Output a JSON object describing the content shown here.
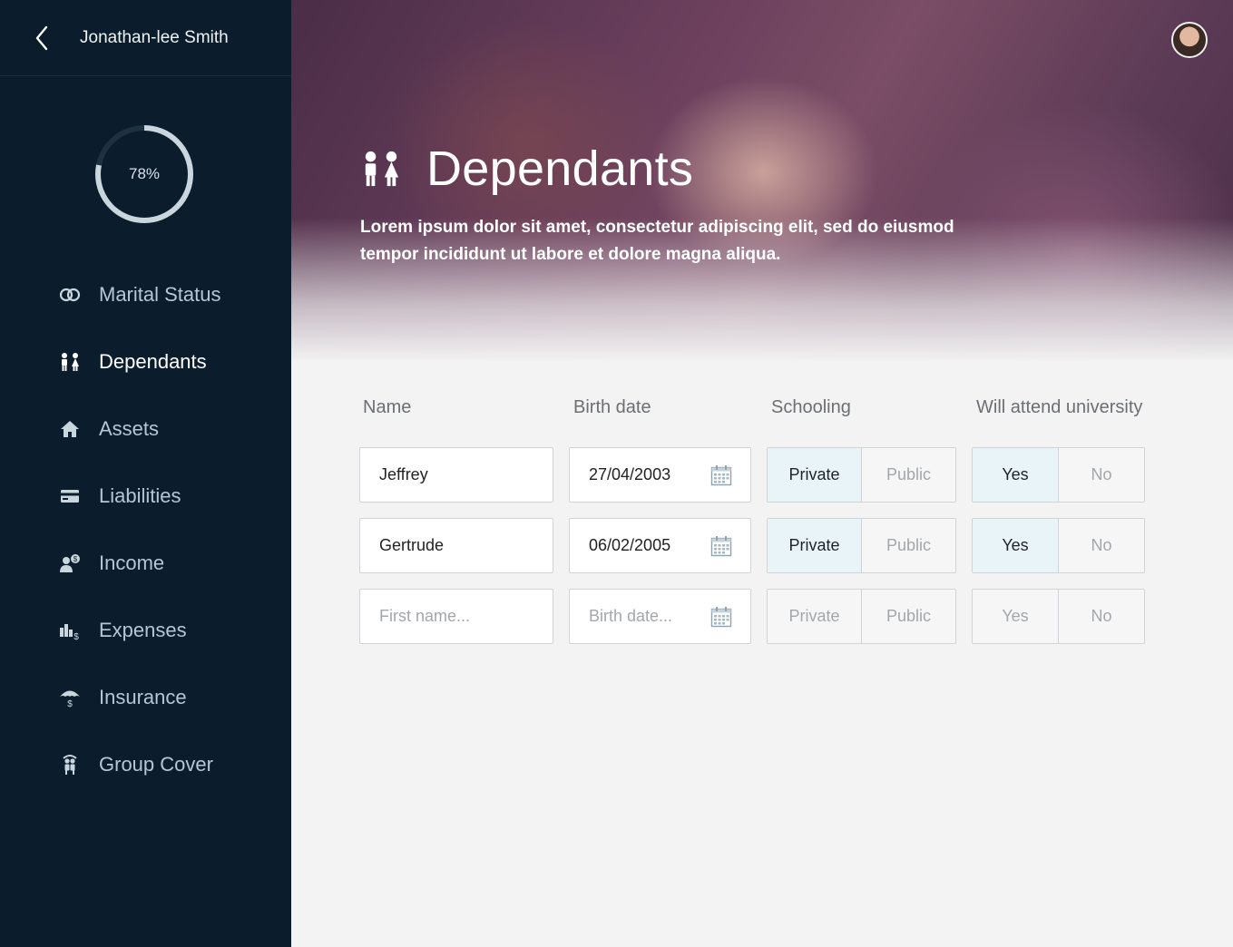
{
  "sidebar": {
    "user_name": "Jonathan-lee Smith",
    "progress": {
      "label": "78%",
      "value": 0.78
    },
    "items": [
      {
        "label": "Marital Status",
        "icon": "rings-icon",
        "active": false
      },
      {
        "label": "Dependants",
        "icon": "children-icon",
        "active": true
      },
      {
        "label": "Assets",
        "icon": "home-icon",
        "active": false
      },
      {
        "label": "Liabilities",
        "icon": "credit-card-icon",
        "active": false
      },
      {
        "label": "Income",
        "icon": "income-icon",
        "active": false
      },
      {
        "label": "Expenses",
        "icon": "expenses-icon",
        "active": false
      },
      {
        "label": "Insurance",
        "icon": "umbrella-icon",
        "active": false
      },
      {
        "label": "Group Cover",
        "icon": "group-icon",
        "active": false
      }
    ]
  },
  "hero": {
    "title": "Dependants",
    "description": "Lorem ipsum dolor sit amet, consectetur adipiscing elit, sed do eiusmod tempor incididunt ut labore et dolore magna aliqua."
  },
  "table": {
    "headers": {
      "name": "Name",
      "birth_date": "Birth date",
      "schooling": "Schooling",
      "university": "Will attend university"
    },
    "rows": [
      {
        "name": "Jeffrey",
        "birth_date": "27/04/2003",
        "private": "Private",
        "public": "Public",
        "yes": "Yes",
        "no": "No",
        "schooling": "Private",
        "university": "Yes"
      },
      {
        "name": "Gertrude",
        "birth_date": "06/02/2005",
        "private": "Private",
        "public": "Public",
        "yes": "Yes",
        "no": "No",
        "schooling": "Private",
        "university": "Yes"
      }
    ],
    "new_row": {
      "name_placeholder": "First name...",
      "birth_date_placeholder": "Birth date...",
      "private": "Private",
      "public": "Public",
      "yes": "Yes",
      "no": "No"
    }
  },
  "colors": {
    "sidebar_bg": "#0b1c2c",
    "accent": "#c9d6de",
    "selected_bg": "#e9f4f8",
    "page_bg": "#f3f3f3"
  }
}
